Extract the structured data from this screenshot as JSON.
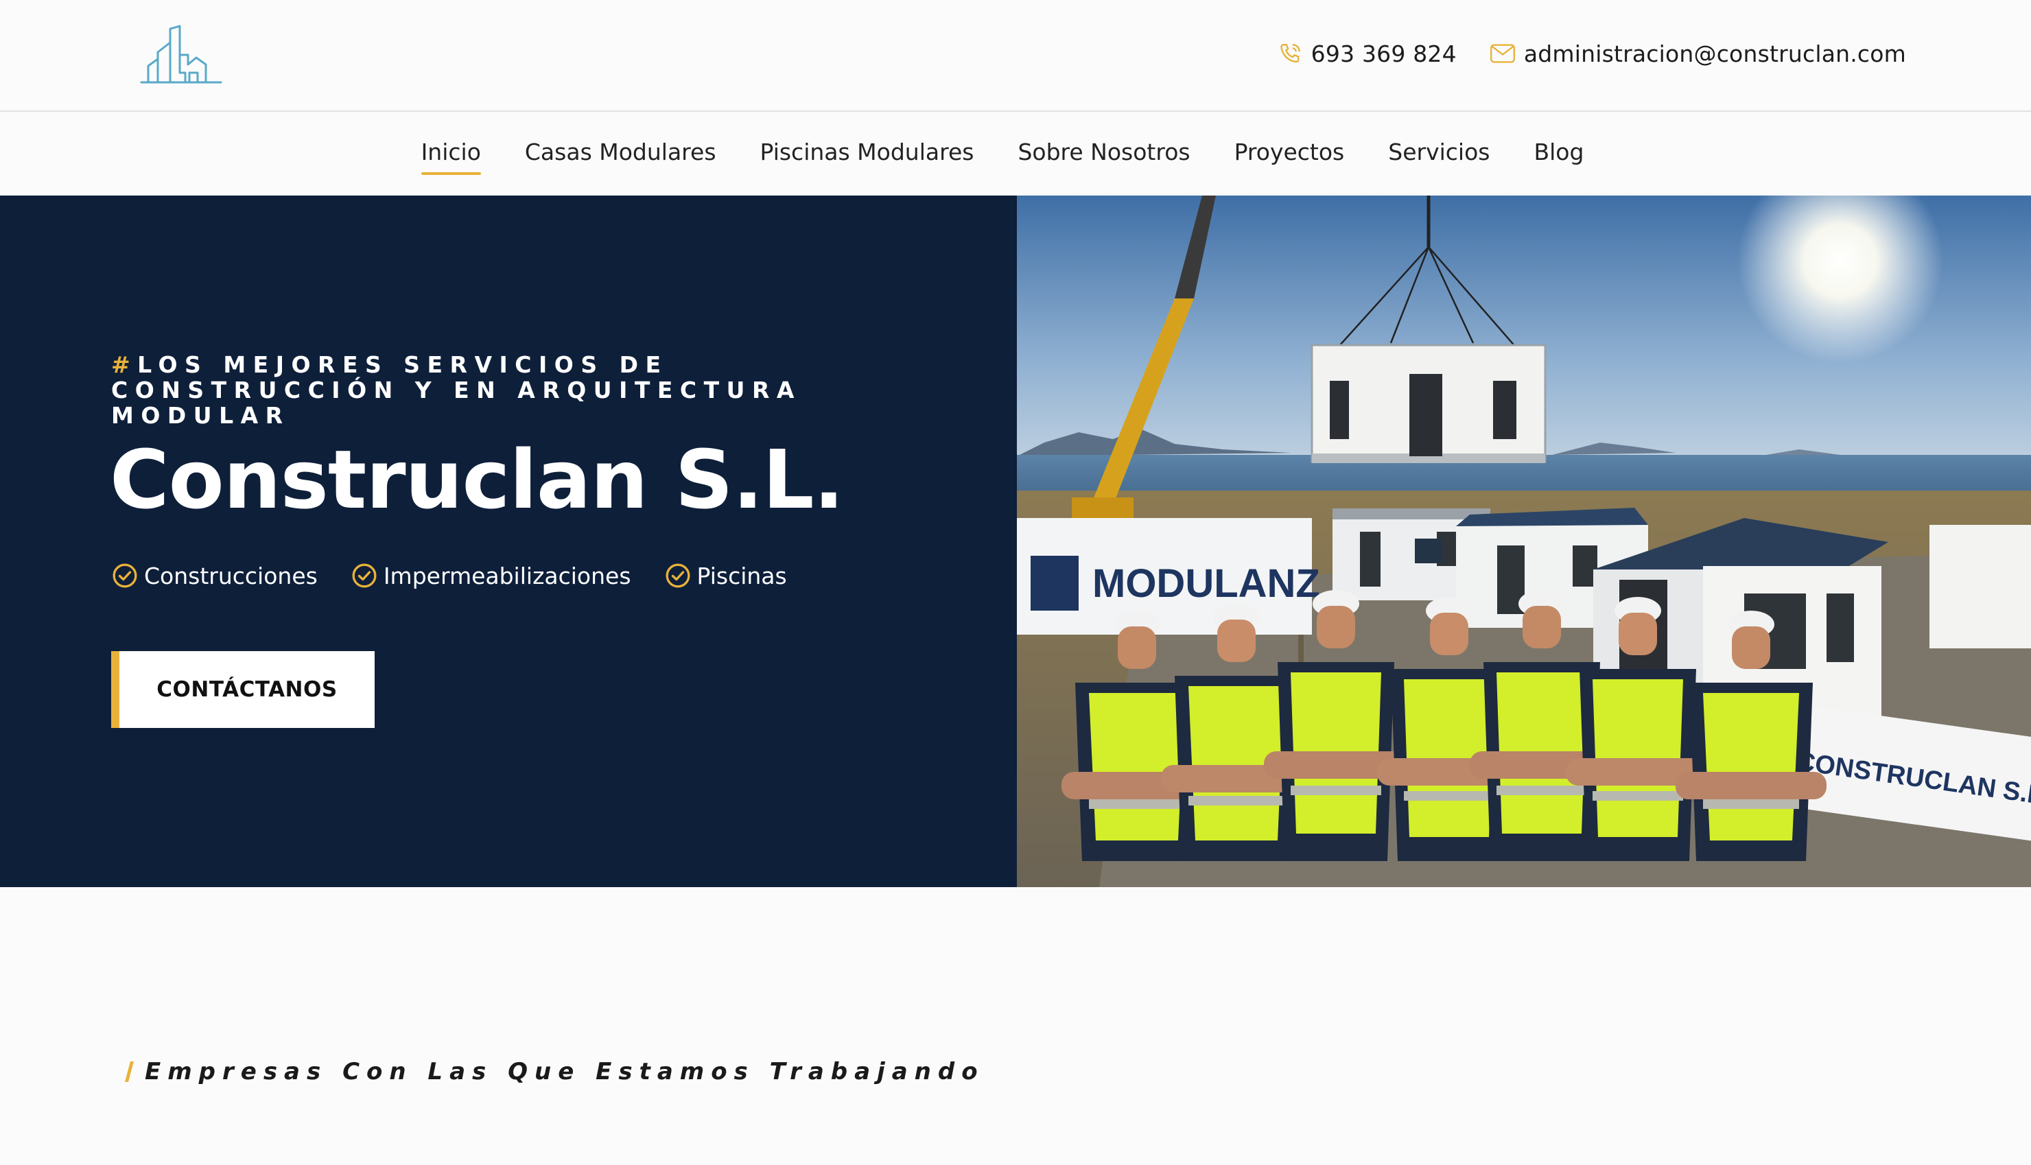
{
  "header": {
    "phone": "693 369 824",
    "email": "administracion@construclan.com"
  },
  "nav": {
    "items": [
      "Inicio",
      "Casas Modulares",
      "Piscinas Modulares",
      "Sobre Nosotros",
      "Proyectos",
      "Servicios",
      "Blog"
    ],
    "active": "Inicio"
  },
  "hero": {
    "tagline_hash": "#",
    "tagline": "LOS MEJORES SERVICIOS DE CONSTRUCCIÓN Y EN ARQUITECTURA MODULAR",
    "title": "Construclan S.L.",
    "features": [
      "Construcciones",
      "Impermeabilizaciones",
      "Piscinas"
    ],
    "cta_label": "CONTÁCTANOS",
    "photo": {
      "sign_left": "MODULANZ",
      "sign_right": "CONSTRUCLAN S.L."
    }
  },
  "partners": {
    "heading": "Empresas Con Las Que Estamos Trabajando"
  },
  "colors": {
    "accent": "#e8b23a",
    "navy": "#0e1f3a",
    "logo_teal": "#5aa9c9"
  },
  "icons": {
    "phone": "phone-icon",
    "email": "mail-icon",
    "feature": "check-circle-icon",
    "logo": "building-logo-icon"
  }
}
